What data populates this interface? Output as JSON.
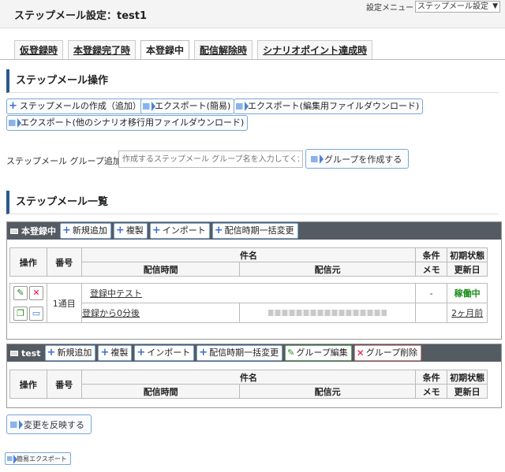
{
  "window": {
    "title": "ステップメール設定：test1"
  },
  "settings_menu": {
    "label": "設定メニュー",
    "selected": "ステップメール設定"
  },
  "tabs": [
    {
      "label": "仮登録時",
      "active": false
    },
    {
      "label": "本登録完了時",
      "active": false
    },
    {
      "label": "本登録中",
      "active": true
    },
    {
      "label": "配信解除時",
      "active": false
    },
    {
      "label": "シナリオポイント達成時",
      "active": false
    }
  ],
  "ops": {
    "title": "ステップメール操作",
    "create_label": "ステップメールの作成（追加）",
    "export_simple_label": "エクスポート(簡易)",
    "export_edit_label": "エクスポート(編集用ファイルダウンロード)",
    "export_migrate_label": "エクスポート(他のシナリオ移行用ファイルダウンロード)"
  },
  "group_add": {
    "label": "ステップメール グループ追加",
    "placeholder": "作成するステップメール グループ名を入力してくだ",
    "button_label": "グループを作成する"
  },
  "list": {
    "title": "ステップメール一覧"
  },
  "table_headers": {
    "ops": "操作",
    "number": "番号",
    "subject": "件名",
    "send_time": "配信時間",
    "sender": "配信元",
    "condition": "条件",
    "memo": "メモ",
    "init_state": "初期状態",
    "updated": "更新日"
  },
  "group1": {
    "name": "本登録中",
    "buttons": {
      "add": "新規追加",
      "copy": "複製",
      "import": "インポート",
      "bulk": "配信時期一括変更"
    },
    "row": {
      "number": "1通目",
      "subject": "登録中テスト",
      "send_time": "登録から0分後",
      "condition": "-",
      "state": "稼働中",
      "updated": "2ヶ月前"
    }
  },
  "group2": {
    "name": "test",
    "buttons": {
      "add": "新規追加",
      "copy": "複製",
      "import": "インポート",
      "bulk": "配信時期一括変更",
      "edit": "グループ編集",
      "delete": "グループ削除"
    }
  },
  "footer": {
    "reflect_label": "変更を反映する",
    "simple_export_label": "簡易エクスポート"
  },
  "colors": {
    "accent": "#2b5a8c",
    "header_bg": "#555b63",
    "active_state": "#1a8a1a"
  }
}
